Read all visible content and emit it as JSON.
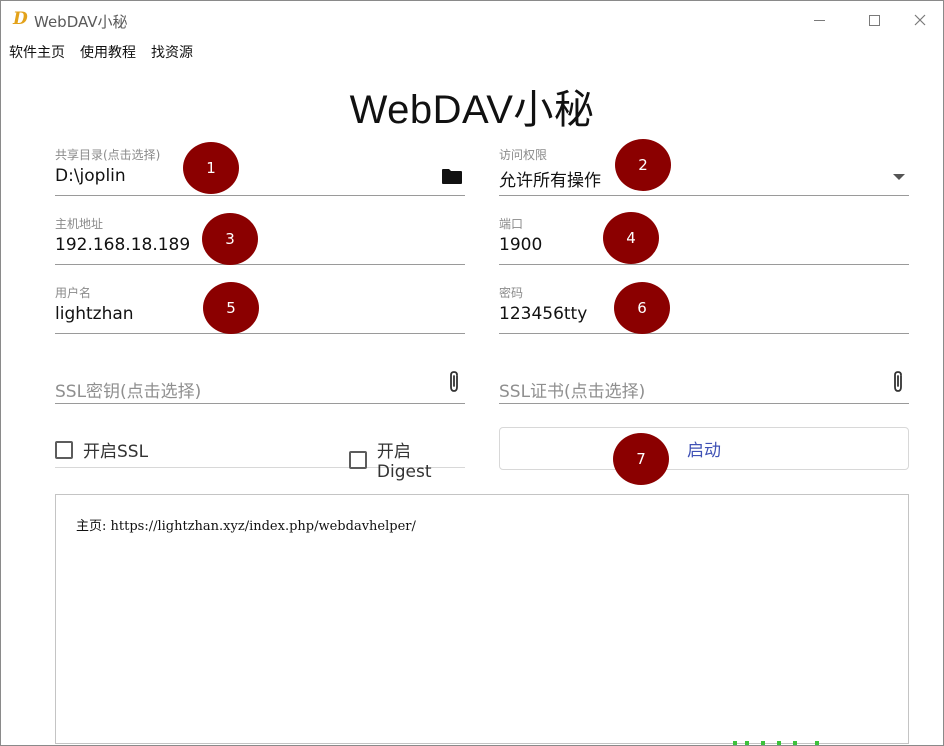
{
  "window": {
    "logo_letter": "D",
    "title": "WebDAV小秘"
  },
  "menu": [
    "软件主页",
    "使用教程",
    "找资源"
  ],
  "heading": "WebDAV小秘",
  "fields": {
    "share_dir": {
      "label": "共享目录(点击选择)",
      "value": "D:\\joplin"
    },
    "access": {
      "label": "访问权限",
      "value": "允许所有操作"
    },
    "host": {
      "label": "主机地址",
      "value": "192.168.18.189"
    },
    "port": {
      "label": "端口",
      "value": "1900"
    },
    "username": {
      "label": "用户名",
      "value": "lightzhan"
    },
    "password": {
      "label": "密码",
      "value": "123456tty"
    },
    "ssl_key": {
      "placeholder": "SSL密钥(点击选择)"
    },
    "ssl_cert": {
      "placeholder": "SSL证书(点击选择)"
    }
  },
  "checkboxes": {
    "ssl": {
      "label": "开启SSL",
      "checked": false
    },
    "digest": {
      "label": "开启Digest",
      "checked": false
    }
  },
  "start_button": "启动",
  "log": "主页: https://lightzhan.xyz/index.php/webdavhelper/",
  "markers": [
    "1",
    "2",
    "3",
    "4",
    "5",
    "6",
    "7"
  ],
  "colors": {
    "marker": "#8b0000",
    "button_text": "#3f51b5",
    "logo": "#e3a21a"
  },
  "icons": [
    "folder-icon",
    "dropdown-arrow-icon",
    "paperclip-icon",
    "minimize-icon",
    "maximize-icon",
    "close-icon"
  ]
}
